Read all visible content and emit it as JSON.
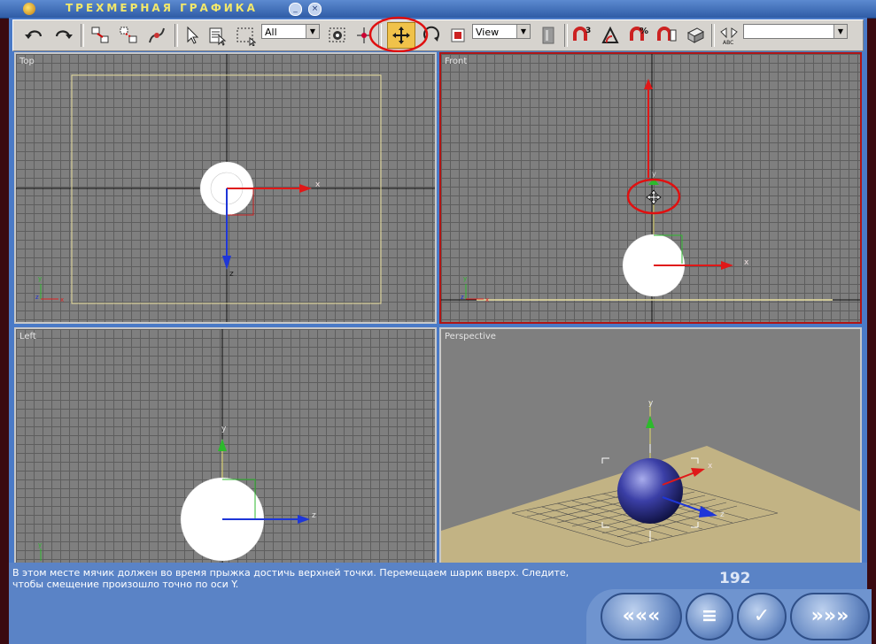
{
  "window": {
    "title": "ТРЕХМЕРНАЯ ГРАФИКА",
    "minimize_glyph": "_",
    "close_glyph": "×"
  },
  "toolbar": {
    "selection_filter": "All",
    "coordinate_system": "View",
    "named_selection": "",
    "highlighted_tool": "select-and-move"
  },
  "viewports": {
    "top": "Top",
    "front": "Front",
    "left": "Left",
    "perspective": "Perspective"
  },
  "axes": {
    "x": "x",
    "y": "y",
    "z": "z"
  },
  "caption": {
    "text": "В этом месте мячик должен во время прыжка достичь верхней точки. Перемещаем шарик вверх. Следите, чтобы смещение произошло точно по оси Y."
  },
  "page": {
    "number": "192"
  },
  "nav": {
    "back_glyph": "«««",
    "contents_glyph": "≡",
    "check_glyph": "✓",
    "forward_glyph": "»»»"
  },
  "colors": {
    "active_viewport_border": "#b01515",
    "highlight_circle": "#e01010",
    "active_tool_bg": "#f0c24a",
    "sphere": "#2c2f8c"
  }
}
